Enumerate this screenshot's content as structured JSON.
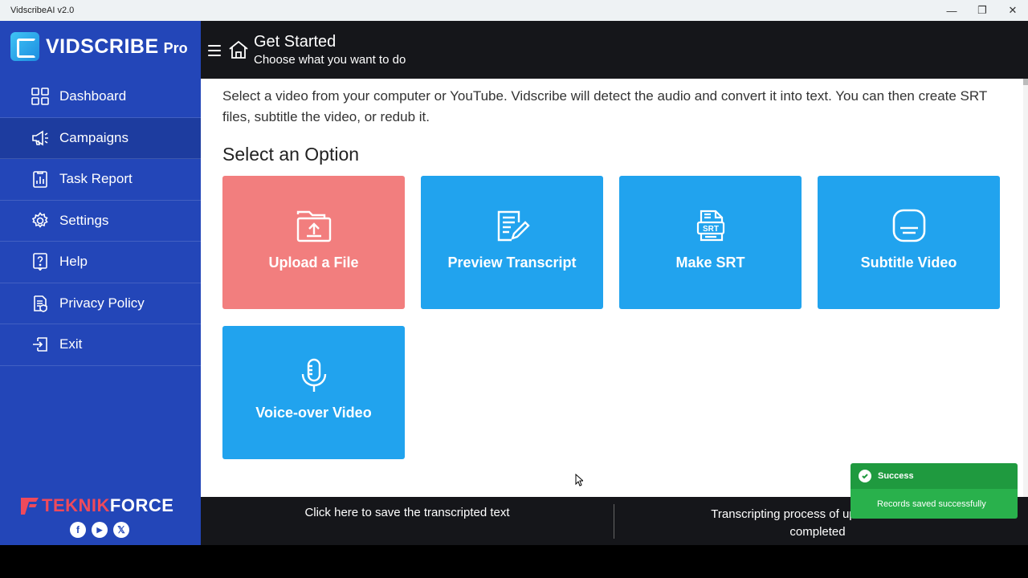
{
  "window": {
    "title": "VidscribeAI v2.0",
    "minimize_glyph": "—",
    "maximize_glyph": "❐",
    "close_glyph": "✕"
  },
  "sidebar": {
    "logo_text": "VIDSCRIBE",
    "logo_pro": "Pro",
    "items": [
      {
        "label": "Dashboard",
        "icon": "dashboard-icon"
      },
      {
        "label": "Campaigns",
        "icon": "megaphone-icon",
        "active": true
      },
      {
        "label": "Task Report",
        "icon": "report-icon"
      },
      {
        "label": "Settings",
        "icon": "gear-icon"
      },
      {
        "label": "Help",
        "icon": "help-icon"
      },
      {
        "label": "Privacy Policy",
        "icon": "policy-icon"
      },
      {
        "label": "Exit",
        "icon": "exit-icon"
      }
    ],
    "brand_part1": "TEKNIK",
    "brand_part2": "FORCE",
    "socials": [
      {
        "glyph": "f",
        "icon": "facebook-icon"
      },
      {
        "glyph": "▶",
        "icon": "youtube-icon"
      },
      {
        "glyph": "𝕏",
        "icon": "x-icon"
      }
    ]
  },
  "header": {
    "title": "Get Started",
    "subtitle": "Choose what you want to do"
  },
  "main": {
    "intro": "Select a video from your computer or YouTube. Vidscribe will detect the audio and convert it into text. You can then create SRT files, subtitle the video, or redub it.",
    "section_title": "Select an Option",
    "cards": [
      {
        "label": "Upload a File",
        "icon": "upload-folder-icon",
        "color": "#f27e7e"
      },
      {
        "label": "Preview Transcript",
        "icon": "edit-document-icon",
        "color": "#21a3ee"
      },
      {
        "label": "Make SRT",
        "icon": "srt-file-icon",
        "color": "#21a3ee"
      },
      {
        "label": "Subtitle Video",
        "icon": "subtitles-icon",
        "color": "#21a3ee"
      },
      {
        "label": "Voice-over Video",
        "icon": "microphone-icon",
        "color": "#21a3ee"
      }
    ]
  },
  "footer": {
    "save_text": "Click here to save the transcripted text",
    "status_text_line1": "Transcripting process of uploaded video",
    "status_text_line2": "completed"
  },
  "toast": {
    "title": "Success",
    "message": "Records saved successfully"
  },
  "colors": {
    "sidebar": "#2346b8",
    "sidebar_active": "#1d3c9f",
    "header": "#15161a",
    "card_blue": "#21a3ee",
    "card_red": "#f27e7e",
    "toast_green": "#29b14c"
  }
}
